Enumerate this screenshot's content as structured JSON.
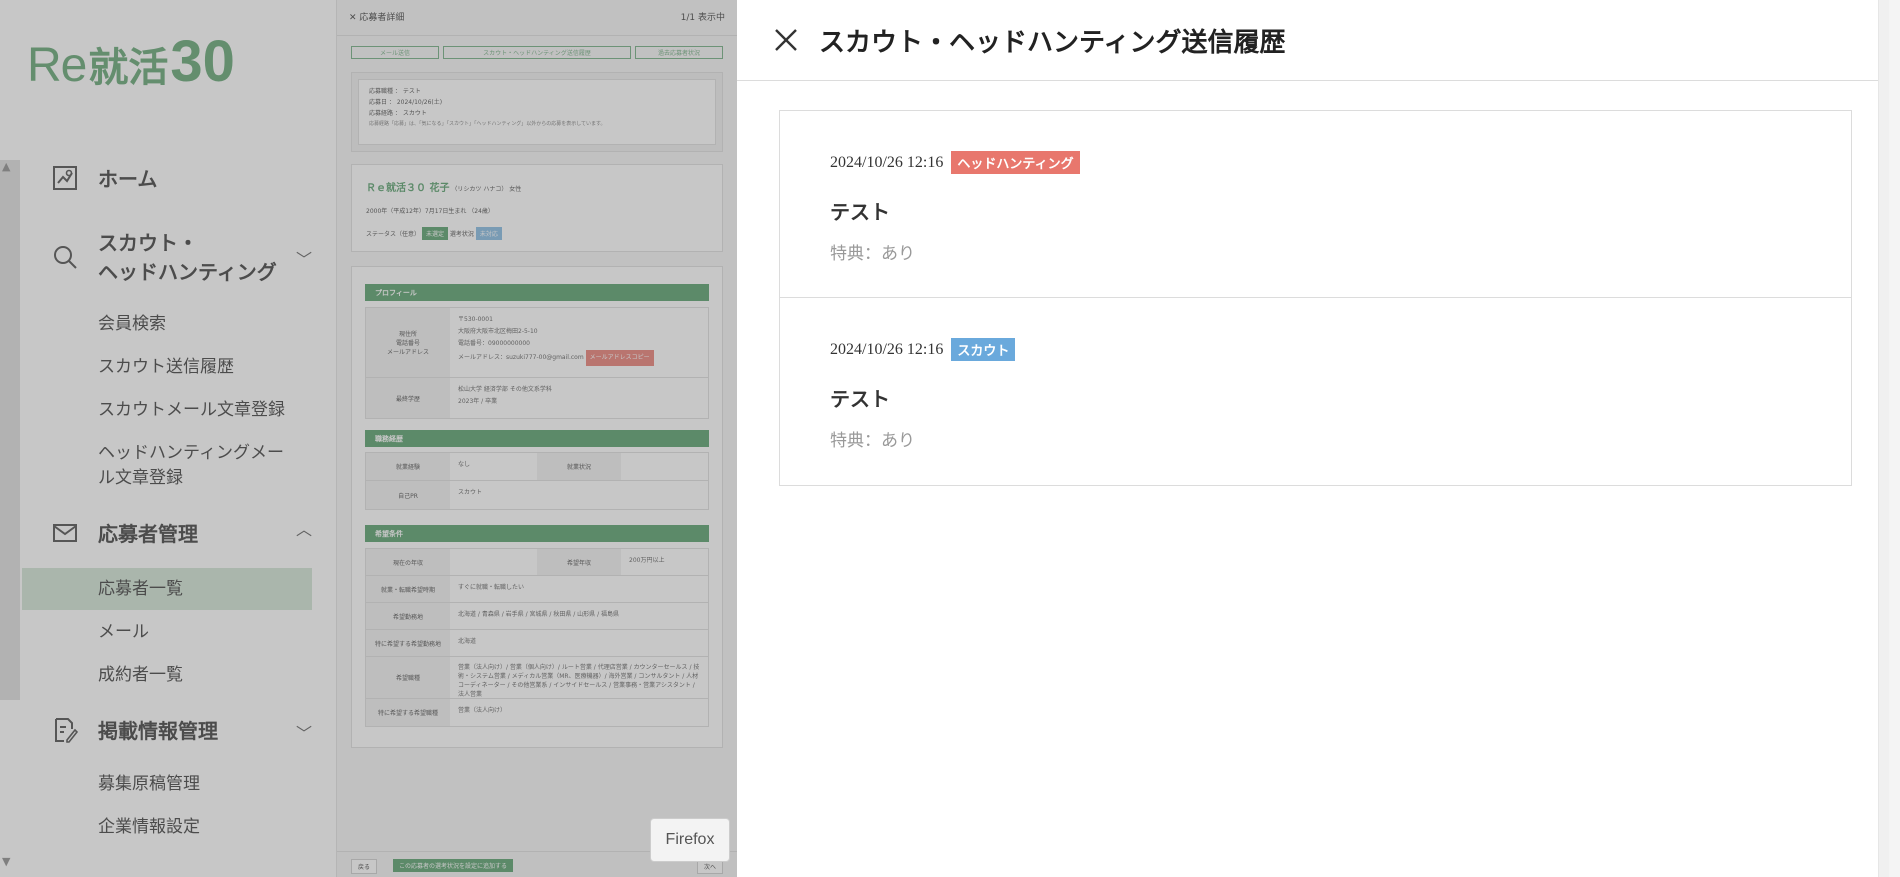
{
  "logo": {
    "re": "Re",
    "kanji": "就活",
    "num": "30"
  },
  "sidebar": {
    "home": "ホーム",
    "scout": [
      "スカウト・",
      "ヘッドハンティング"
    ],
    "scout_items": [
      "会員検索",
      "スカウト送信履歴",
      "スカウトメール文章登録",
      "ヘッドハンティングメー",
      "ル文章登録"
    ],
    "applicants": "応募者管理",
    "applicant_items": [
      "応募者一覧",
      "メール",
      "成約者一覧"
    ],
    "listing": "掲載情報管理",
    "listing_items": [
      "募集原稿管理",
      "企業情報設定"
    ]
  },
  "detail": {
    "title": "応募者詳細",
    "page_info": "1/1 表示中",
    "buttons": [
      "メール送信",
      "スカウト・ヘッドハンティング送信履歴",
      "過去応募者状況"
    ],
    "apply_info": [
      "応募職種 ： テスト",
      "応募日 ： 2024/10/26(土)",
      "応募経路 ： スカウト",
      "応募経路「応募」は、「気になる」「スカウト」「ヘッドハンティング」以外からの応募を表示しています。"
    ],
    "applicant_name": "Ｒｅ就活３０ 花子",
    "applicant_kana": "（リシカツ ハナコ） 女性",
    "birth": "2000年（平成12年）7月17日生まれ （24歳）",
    "status_label": "ステータス（任意）",
    "status_value": "未選定",
    "read_label": "選考状況",
    "read_value": "未対応",
    "sections": [
      "プロフィール",
      "職務経歴",
      "希望条件"
    ],
    "profile_rows": [
      {
        "h": "現住所\n電話番号\nメールアドレス",
        "v": "〒530-0001\n大阪府大阪市北区梅田2-5-10\n電話番号：09000000000\nメールアドレス：suzuki777-00@gmail.com"
      },
      {
        "h": "最終学歴",
        "v": "松山大学 経済学部 その他文系学科\n2023年 / 卒業"
      }
    ],
    "copy_btn": "メールアドレスコピー",
    "career_rows": [
      {
        "h": "就業経験",
        "v": "なし",
        "h2": "就業状況",
        "v2": ""
      },
      {
        "h": "自己PR",
        "v": "スカウト"
      }
    ],
    "wish_rows": [
      {
        "h": "現在の年収",
        "v": "",
        "h2": "希望年収",
        "v2": "200万円以上"
      },
      {
        "h": "就業・転職希望時期",
        "v": "すぐに就職・転職したい"
      },
      {
        "h": "希望勤務地",
        "v": "北海道 / 青森県 / 岩手県 / 宮城県 / 秋田県 / 山形県 / 福島県"
      },
      {
        "h": "特に希望する希望勤務地",
        "v": "北海道"
      },
      {
        "h": "希望職種",
        "v": "営業（法人向け）/ 営業（個人向け）/ ルート営業 / 代理店営業 / カウンターセールス / 技術・システム営業 / メディカル営業（MR、医療機器）/ 海外営業 / コンサルタント / 人材コーディネーター / その他営業系 / インサイドセールス / 営業事務・営業アシスタント / 法人営業"
      },
      {
        "h": "特に希望する希望職種",
        "v": "営業（法人向け）"
      }
    ],
    "footer_back": "戻る",
    "footer_action": "この応募者の選考状況を設定に追加する",
    "footer_next": "次へ"
  },
  "tooltip": "Firefox",
  "panel": {
    "title": "スカウト・ヘッドハンティング送信履歴",
    "items": [
      {
        "date": "2024/10/26 12:16",
        "badge": "ヘッドハンティング",
        "badge_color": "#e8776d",
        "name": "テスト",
        "perk": "特典：あり"
      },
      {
        "date": "2024/10/26 12:16",
        "badge": "スカウト",
        "badge_color": "#6aa9dc",
        "name": "テスト",
        "perk": "特典：あり"
      }
    ]
  },
  "colors": {
    "brand_green": "#5aa06c",
    "section_green": "#4e9a63",
    "active_bg": "#cfe3d3"
  }
}
